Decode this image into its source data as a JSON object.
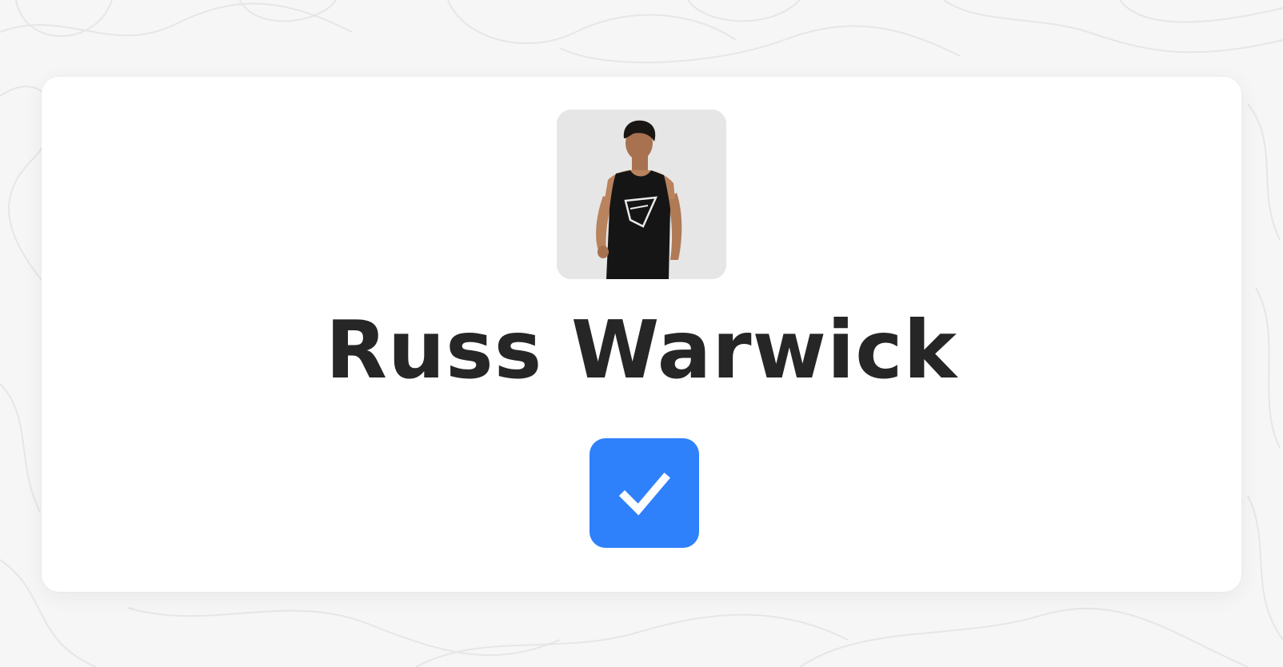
{
  "profile": {
    "name": "Russ Warwick",
    "avatar_icon": "person-photo-icon",
    "verified_icon": "checkmark-icon"
  },
  "colors": {
    "page_background": "#f6f6f6",
    "card_background": "#ffffff",
    "name_text": "#262626",
    "verified_badge": "#2f80fb",
    "avatar_background": "#e6e6e6"
  }
}
